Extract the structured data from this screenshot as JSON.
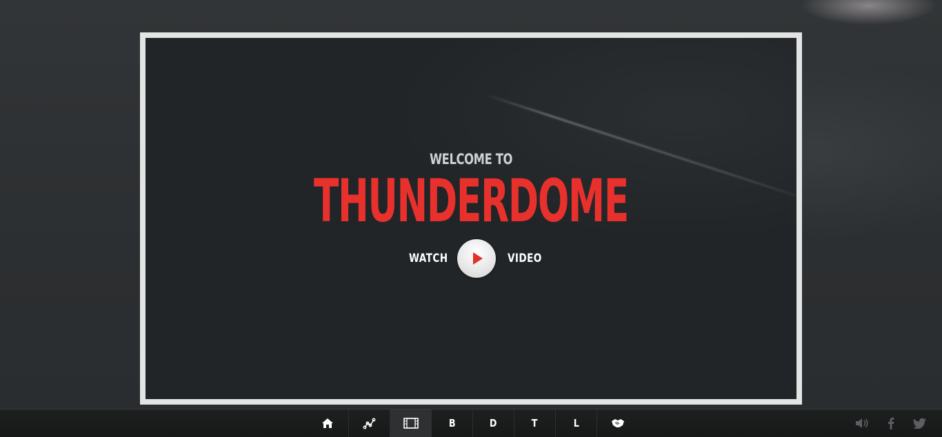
{
  "hero": {
    "welcome": "WELCOME TO",
    "title": "THUNDERDOME",
    "watch_label": "WATCH",
    "video_label": "VIDEO",
    "play_icon": "play-icon"
  },
  "nav": {
    "items": [
      {
        "icon": "home-icon",
        "label": ""
      },
      {
        "icon": "graph-icon",
        "label": ""
      },
      {
        "icon": "film-icon",
        "label": "",
        "active": true
      },
      {
        "icon": "",
        "label": "B"
      },
      {
        "icon": "",
        "label": "D"
      },
      {
        "icon": "",
        "label": "T"
      },
      {
        "icon": "",
        "label": "L"
      },
      {
        "icon": "handshake-icon",
        "label": ""
      }
    ]
  },
  "social": {
    "items": [
      "volume-icon",
      "facebook-icon",
      "twitter-icon"
    ]
  },
  "colors": {
    "accent": "#e8312d",
    "frame_border": "#e3e4e4",
    "background": "#2e3133"
  }
}
